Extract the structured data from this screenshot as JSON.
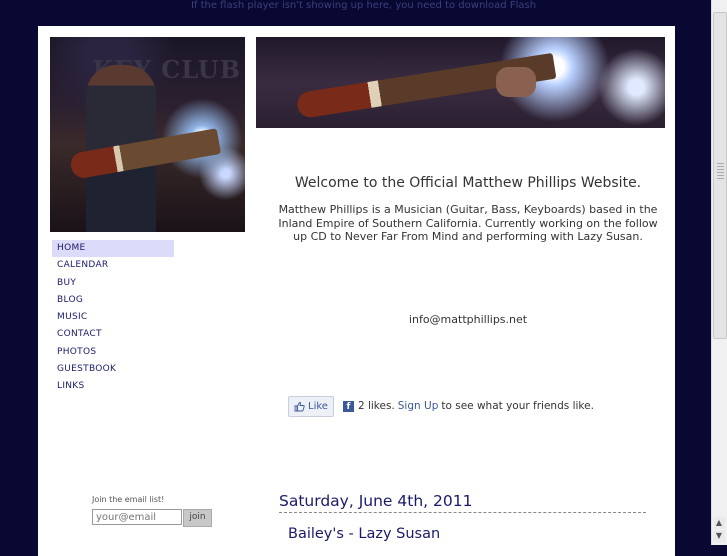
{
  "flash_notice": "If the flash player isn't showing up here, you need to download Flash",
  "header": {
    "photo_sign_text": "KEY CLUB"
  },
  "nav": {
    "items": [
      {
        "label": "HOME",
        "active": true
      },
      {
        "label": "CALENDAR"
      },
      {
        "label": "BUY"
      },
      {
        "label": "BLOG"
      },
      {
        "label": "MUSIC"
      },
      {
        "label": "CONTACT"
      },
      {
        "label": "PHOTOS"
      },
      {
        "label": "GUESTBOOK"
      },
      {
        "label": "LINKS"
      }
    ]
  },
  "main": {
    "welcome_title": "Welcome to the Official Matthew Phillips Website.",
    "intro": "Matthew Phillips is a Musician (Guitar, Bass, Keyboards) based in the Inland Empire of Southern California. Currently working on the follow up CD to Never Far From Mind and performing with Lazy Susan.",
    "email": "info@mattphillips.net"
  },
  "facebook": {
    "like_label": "Like",
    "likes_text": "2 likes.",
    "signup_label": "Sign Up",
    "signup_suffix": "to see what your friends like."
  },
  "email_list": {
    "label": "Join the email list!",
    "placeholder": "your@email",
    "button_label": "join"
  },
  "calendar": {
    "date": "Saturday, June 4th, 2011",
    "event": "Bailey's - Lazy Susan"
  },
  "colors": {
    "background": "#080833",
    "nav_text": "#1a1a6a",
    "nav_active": "#dcdcfa",
    "facebook_blue": "#3b5998"
  }
}
